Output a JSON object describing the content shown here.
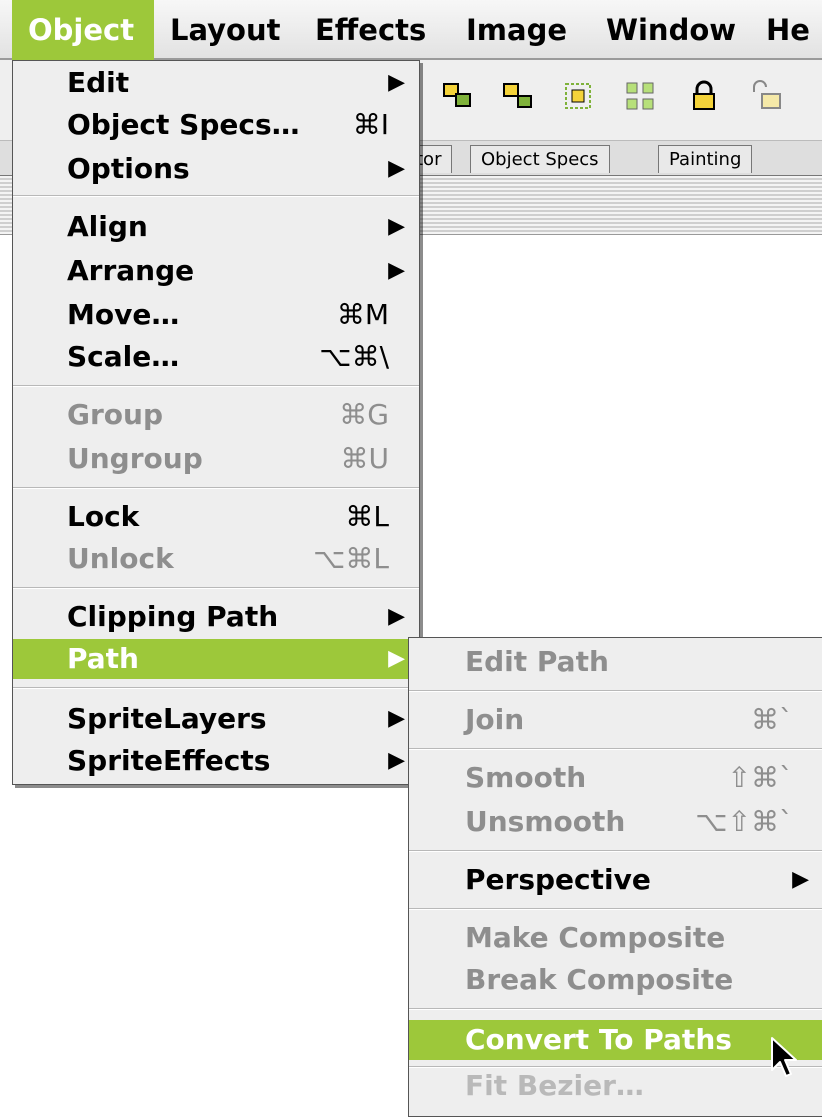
{
  "menubar": {
    "items": [
      {
        "label": "Object",
        "active": true
      },
      {
        "label": "Layout",
        "active": false
      },
      {
        "label": "Effects",
        "active": false
      },
      {
        "label": "Image",
        "active": false
      },
      {
        "label": "Window",
        "active": false
      },
      {
        "label": "He",
        "active": false
      }
    ]
  },
  "toolbar": {
    "icons": [
      "group-icon",
      "ungroup-icon",
      "align-icon",
      "distribute-icon",
      "lock-icon",
      "unlock-icon"
    ]
  },
  "tabs": [
    "tor",
    "Object Specs",
    "Painting"
  ],
  "object_menu": {
    "items": [
      {
        "label": "Edit",
        "shortcut": "",
        "submenu": true,
        "disabled": false
      },
      {
        "label": "Object Specs…",
        "shortcut": "⌘I",
        "submenu": false,
        "disabled": false
      },
      {
        "label": "Options",
        "shortcut": "",
        "submenu": true,
        "disabled": false
      },
      {
        "label": "Align",
        "shortcut": "",
        "submenu": true,
        "disabled": false
      },
      {
        "label": "Arrange",
        "shortcut": "",
        "submenu": true,
        "disabled": false
      },
      {
        "label": "Move…",
        "shortcut": "⌘M",
        "submenu": false,
        "disabled": false
      },
      {
        "label": "Scale…",
        "shortcut": "⌥⌘\\",
        "submenu": false,
        "disabled": false
      },
      {
        "label": "Group",
        "shortcut": "⌘G",
        "submenu": false,
        "disabled": true
      },
      {
        "label": "Ungroup",
        "shortcut": "⌘U",
        "submenu": false,
        "disabled": true
      },
      {
        "label": "Lock",
        "shortcut": "⌘L",
        "submenu": false,
        "disabled": false
      },
      {
        "label": "Unlock",
        "shortcut": "⌥⌘L",
        "submenu": false,
        "disabled": true
      },
      {
        "label": "Clipping Path",
        "shortcut": "",
        "submenu": true,
        "disabled": false
      },
      {
        "label": "Path",
        "shortcut": "",
        "submenu": true,
        "disabled": false,
        "highlighted": true
      },
      {
        "label": "SpriteLayers",
        "shortcut": "",
        "submenu": true,
        "disabled": false
      },
      {
        "label": "SpriteEffects",
        "shortcut": "",
        "submenu": true,
        "disabled": false
      }
    ]
  },
  "path_submenu": {
    "items": [
      {
        "label": "Edit Path",
        "shortcut": "",
        "submenu": false,
        "disabled": true
      },
      {
        "label": "Join",
        "shortcut": "⌘`",
        "submenu": false,
        "disabled": true
      },
      {
        "label": "Smooth",
        "shortcut": "⇧⌘`",
        "submenu": false,
        "disabled": true
      },
      {
        "label": "Unsmooth",
        "shortcut": "⌥⇧⌘`",
        "submenu": false,
        "disabled": true
      },
      {
        "label": "Perspective",
        "shortcut": "",
        "submenu": true,
        "disabled": false
      },
      {
        "label": "Make Composite",
        "shortcut": "",
        "submenu": false,
        "disabled": true
      },
      {
        "label": "Break Composite",
        "shortcut": "",
        "submenu": false,
        "disabled": true
      },
      {
        "label": "Convert To Paths",
        "shortcut": "",
        "submenu": false,
        "disabled": false,
        "highlighted": true
      },
      {
        "label": "Fit Bezier…",
        "shortcut": "",
        "submenu": false,
        "disabled": true
      }
    ]
  },
  "colors": {
    "highlight": "#9dc83a",
    "menu_bg": "#eeeeee",
    "disabled_text": "#8e8e8e"
  }
}
